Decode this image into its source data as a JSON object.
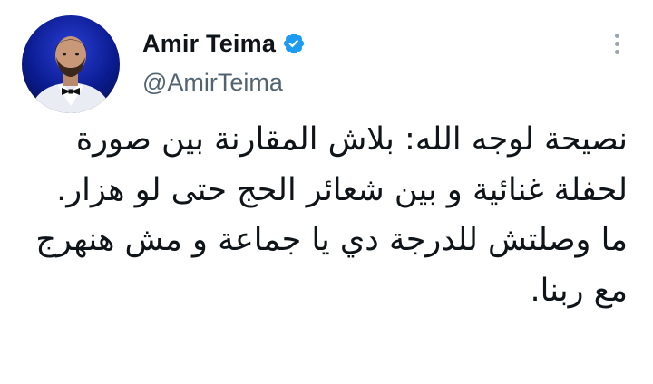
{
  "tweet": {
    "author": {
      "display_name": "Amir Teima",
      "handle": "@AmirTeima",
      "verified": true,
      "avatar_icon": "profile-photo-man-with-bow-tie"
    },
    "more_icon": "vertical-ellipsis-icon",
    "text_paragraphs": [
      "نصيحة لوجه الله: بلاش المقارنة بين صورة لحفلة غنائية و بين شعائر الحج حتى لو هزار.",
      "ما وصلتش للدرجة دي يا جماعة و مش هنهرج مع ربنا."
    ]
  },
  "colors": {
    "name": "#0f1419",
    "handle": "#536471",
    "verified_badge": "#1d9bf0",
    "avatar_background": "#0a1b8f",
    "more_dots": "#9aa4ad"
  }
}
